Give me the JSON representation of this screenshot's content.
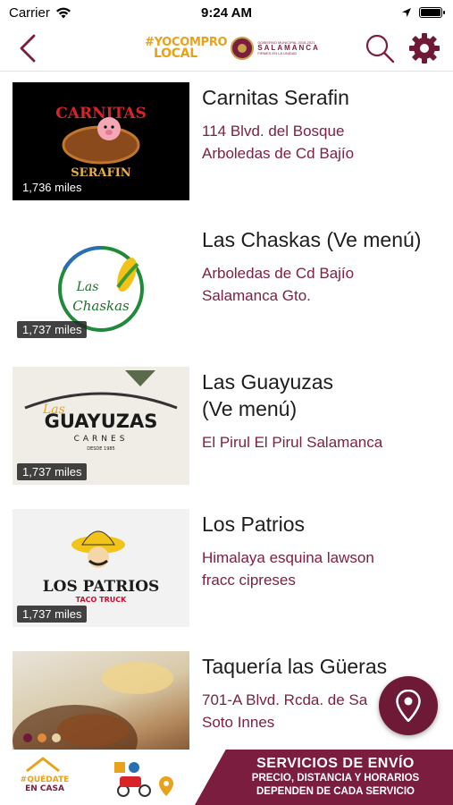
{
  "status_bar": {
    "carrier": "Carrier",
    "time": "9:24 AM",
    "battery_level": 1.0
  },
  "nav": {
    "logo_line1": "#YOCOMPRO",
    "logo_line2": "LOCAL",
    "gov_line1": "GOBIERNO MUNICIPAL 2018-2021",
    "gov_line2": "SALAMANCA",
    "gov_line3": "FIRMES EN LA UNIDAD"
  },
  "restaurants": [
    {
      "name": "Carnitas Serafin",
      "address_lines": [
        "114 Blvd. del Bosque",
        "Arboledas de Cd Bajío"
      ],
      "distance": "1,736 miles",
      "logo_text": [
        "CARNITAS",
        "SERAFIN"
      ]
    },
    {
      "name": "Las Chaskas (Ve menú)",
      "address_lines": [
        "Arboledas de Cd Bajío",
        "Salamanca Gto."
      ],
      "distance": "1,737 miles",
      "logo_text": [
        "Las",
        "Chaskas"
      ]
    },
    {
      "name_lines": [
        "Las Guayuzas",
        "(Ve menú)"
      ],
      "address_lines": [
        "El Pirul El Pirul Salamanca"
      ],
      "distance": "1,737 miles",
      "logo_text": [
        "Las",
        "GUAYUZAS",
        "CARNES",
        "DESDE 1985"
      ]
    },
    {
      "name": "Los Patrios",
      "address_lines": [
        "Himalaya esquina lawson",
        "fracc cipreses"
      ],
      "distance": "1,737 miles",
      "logo_text": [
        "LOS PATRIOS",
        "TACO TRUCK"
      ]
    },
    {
      "name": "Taquería las Güeras",
      "address_lines": [
        "701-A Blvd. Rcda. de Sa",
        "Soto Innes"
      ]
    }
  ],
  "banner": {
    "title": "SERVICIOS DE ENVÍO",
    "subtitle1": "PRECIO, DISTANCIA Y HORARIOS",
    "subtitle2": "DEPENDEN DE CADA SERVICIO",
    "left_logo_line1": "#QUÉDATE",
    "left_logo_line2": "EN CASA"
  },
  "colors": {
    "accent": "#7b1d3f",
    "address": "#7b2145",
    "gold": "#e7a21c"
  },
  "icons": {
    "back": "chevron-left-icon",
    "search": "search-icon",
    "settings": "gear-icon",
    "map": "map-pin-icon"
  }
}
